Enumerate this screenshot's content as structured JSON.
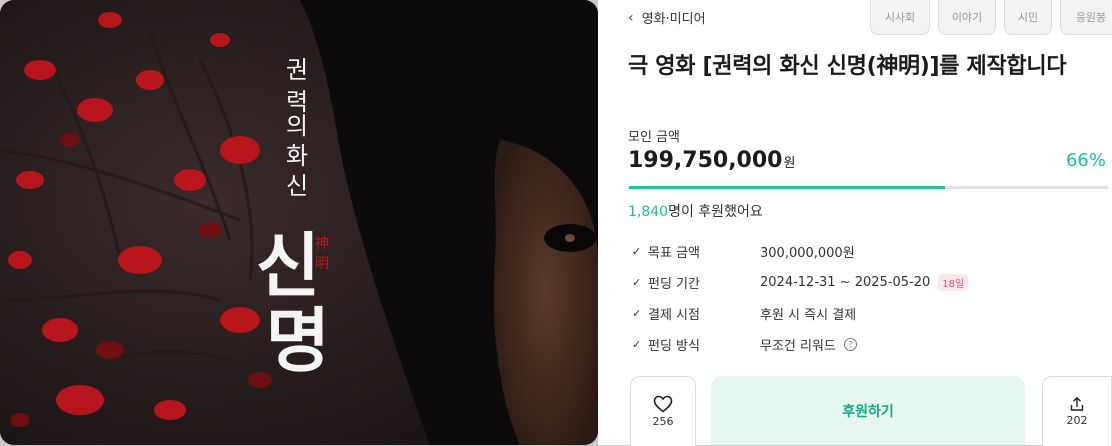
{
  "breadcrumb": {
    "label": "영화·미디어"
  },
  "tabs": [
    {
      "label": "시사회"
    },
    {
      "label": "이야기"
    },
    {
      "label": "시민"
    },
    {
      "label": "응원봉"
    }
  ],
  "project": {
    "title": "극 영화 [권력의 화신 신명(神明)]를 제작합니다"
  },
  "poster": {
    "line1": [
      "권",
      "력",
      "의",
      "화",
      "신"
    ],
    "big": [
      "신",
      "명"
    ],
    "hanja": [
      "神",
      "明"
    ]
  },
  "funding": {
    "label": "모인 금액",
    "amount": "199,750,000",
    "unit": "원",
    "percent_text": "66%",
    "progress": 0.66,
    "supporters_count": "1,840",
    "supporters_suffix": "명이 후원했어요"
  },
  "info": [
    {
      "label": "목표 금액",
      "value": "300,000,000원"
    },
    {
      "label": "펀딩 기간",
      "value": "2024-12-31 ~ 2025-05-20",
      "badge": "18일"
    },
    {
      "label": "결제 시점",
      "value": "후원 시 즉시 결제"
    },
    {
      "label": "펀딩 방식",
      "value": "무조건 리워드"
    }
  ],
  "actions": {
    "like_count": "256",
    "back_label": "후원하기",
    "share_count": "202"
  },
  "colors": {
    "accent": "#1fbf9a",
    "badge": "#e0566a",
    "poster_red": "#c0151d"
  },
  "icons": [
    "chevron-left-icon",
    "check-icon",
    "question-icon",
    "heart-icon",
    "share-icon"
  ]
}
